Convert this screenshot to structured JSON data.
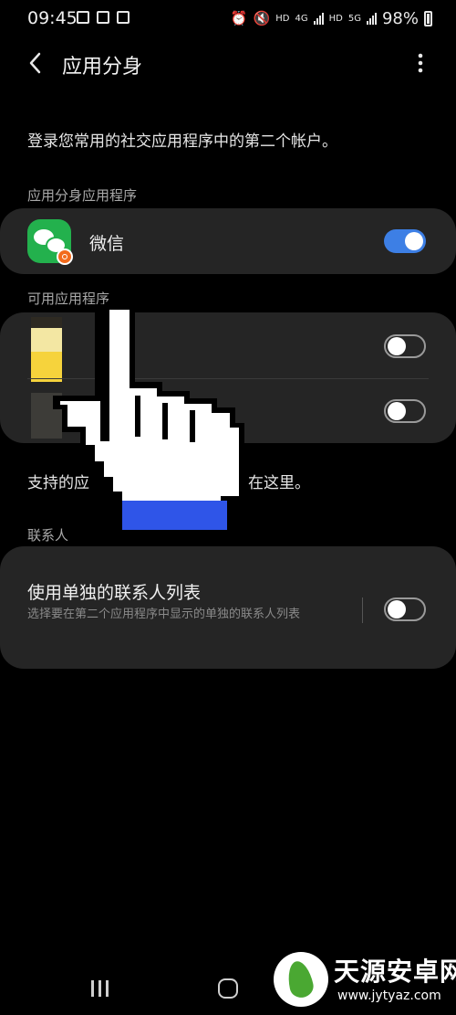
{
  "status_bar": {
    "time": "09:45",
    "left_icons": [
      "image-icon",
      "document-icon",
      "screen-icon"
    ],
    "right_icons": [
      "alarm-icon",
      "mute-icon",
      "signal-icon"
    ],
    "hd1": "HD",
    "net1": "4G",
    "hd2": "HD",
    "net2": "5G",
    "battery": "98%"
  },
  "header": {
    "title": "应用分身"
  },
  "description": "登录您常用的社交应用程序中的第二个帐户。",
  "sections": {
    "clone_apps_label": "应用分身应用程序",
    "available_apps_label": "可用应用程序",
    "contacts_label": "联系人"
  },
  "clone_apps": [
    {
      "name": "微信",
      "enabled": true
    }
  ],
  "available_apps": [
    {
      "enabled": false
    },
    {
      "enabled": false
    }
  ],
  "supported": {
    "text_start": "支持的应",
    "text_end": "在这里。"
  },
  "contacts": {
    "title": "使用单独的联系人列表",
    "description": "选择要在第二个应用程序中显示的单独的联系人列表",
    "enabled": false
  },
  "watermark": {
    "main": "天源安卓网",
    "sub": "www.jytyaz.com"
  },
  "colors": {
    "background": "#000000",
    "card": "#252525",
    "accent": "#3d7fe5",
    "wechat_green": "#23b14d",
    "cursor_blue": "#2f55e8"
  }
}
